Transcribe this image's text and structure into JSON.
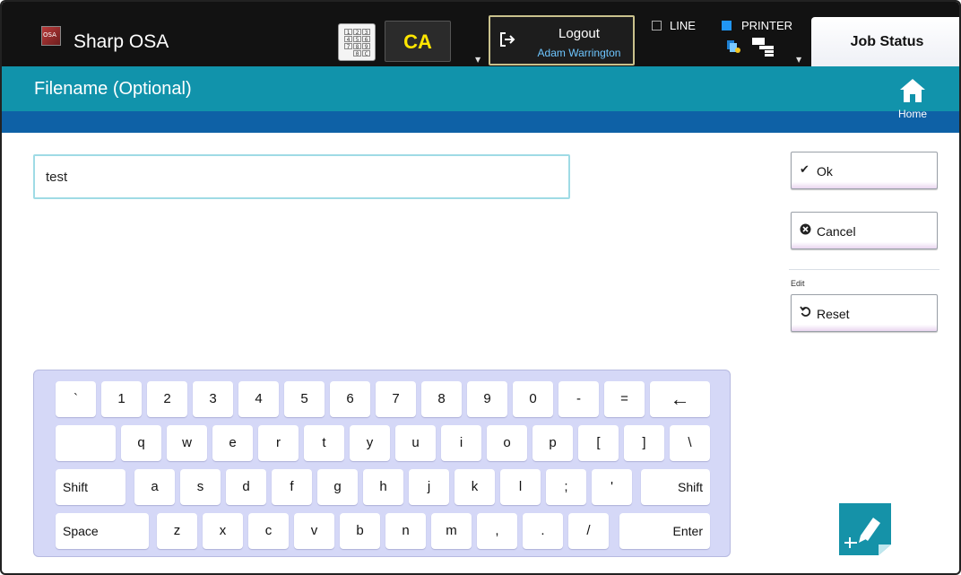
{
  "topbar": {
    "app_title": "Sharp OSA",
    "keypad_keys": [
      "1",
      "2",
      "3",
      "4",
      "5",
      "6",
      "7",
      "8",
      "9",
      "0",
      "C"
    ],
    "ca_label": "CA",
    "logout_label": "Logout",
    "user_name": "Adam Warrington",
    "line_label": "LINE",
    "printer_label": "PRINTER",
    "job_status_label": "Job Status"
  },
  "header": {
    "title": "Filename (Optional)",
    "home_label": "Home"
  },
  "input": {
    "value": "test"
  },
  "actions": {
    "ok_label": "Ok",
    "cancel_label": "Cancel",
    "edit_section_label": "Edit",
    "reset_label": "Reset"
  },
  "keyboard": {
    "row1": [
      "`",
      "1",
      "2",
      "3",
      "4",
      "5",
      "6",
      "7",
      "8",
      "9",
      "0",
      "-",
      "=",
      "←"
    ],
    "row2": [
      "",
      "q",
      "w",
      "e",
      "r",
      "t",
      "y",
      "u",
      "i",
      "o",
      "p",
      "[",
      "]",
      "\\"
    ],
    "row3": [
      "Shift",
      "a",
      "s",
      "d",
      "f",
      "g",
      "h",
      "j",
      "k",
      "l",
      ";",
      "'",
      "Shift"
    ],
    "row4": [
      "Space",
      "z",
      "x",
      "c",
      "v",
      "b",
      "n",
      "m",
      ",",
      ".",
      "/",
      "Enter"
    ]
  },
  "colors": {
    "topbar": "#121212",
    "header": "#1193ab",
    "subband": "#0e61a6",
    "keyboard": "#d5d8f7",
    "ca_text": "#ffe600",
    "user_text": "#6ec6ff"
  }
}
